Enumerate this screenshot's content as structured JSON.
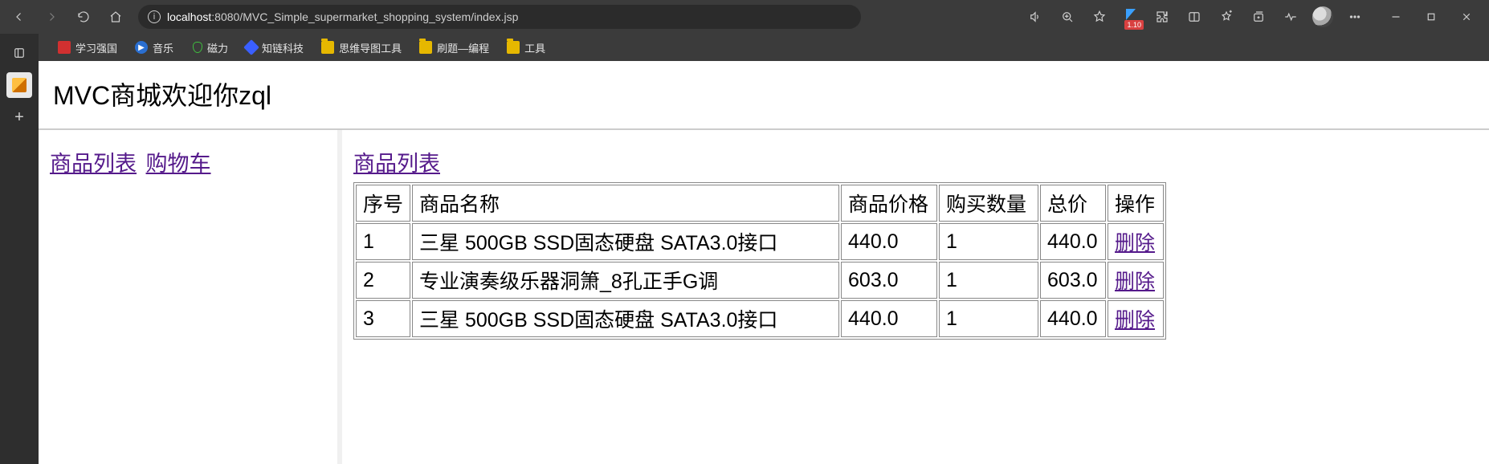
{
  "browser": {
    "url_host": "localhost",
    "url_port": ":8080",
    "url_path": "/MVC_Simple_supermarket_shopping_system/index.jsp",
    "badge": "1.10"
  },
  "bookmarks": [
    {
      "icon": "red",
      "label": "学习强国"
    },
    {
      "icon": "blue",
      "label": "音乐"
    },
    {
      "icon": "green",
      "label": "磁力"
    },
    {
      "icon": "diamond",
      "label": "知链科技"
    },
    {
      "icon": "folder",
      "label": "思维导图工具"
    },
    {
      "icon": "folder",
      "label": "刷题—编程"
    },
    {
      "icon": "folder",
      "label": "工具"
    }
  ],
  "page": {
    "title": "MVC商城欢迎你zql",
    "left_nav": {
      "product_list": "商品列表",
      "cart": "购物车"
    },
    "right": {
      "heading": "商品列表",
      "columns": {
        "seq": "序号",
        "name": "商品名称",
        "price": "商品价格",
        "qty": "购买数量",
        "total": "总价",
        "action": "操作"
      },
      "delete_label": "删除",
      "rows": [
        {
          "seq": "1",
          "name": "三星 500GB SSD固态硬盘 SATA3.0接口",
          "price": "440.0",
          "qty": "1",
          "total": "440.0"
        },
        {
          "seq": "2",
          "name": "专业演奏级乐器洞箫_8孔正手G调",
          "price": "603.0",
          "qty": "1",
          "total": "603.0"
        },
        {
          "seq": "3",
          "name": "三星 500GB SSD固态硬盘 SATA3.0接口",
          "price": "440.0",
          "qty": "1",
          "total": "440.0"
        }
      ]
    }
  }
}
